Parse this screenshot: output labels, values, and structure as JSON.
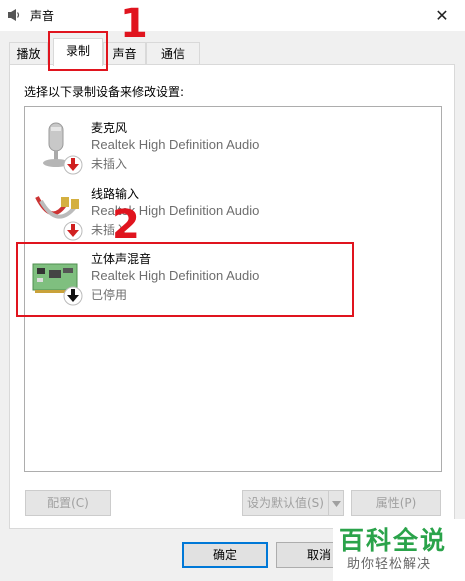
{
  "window": {
    "title": "声音",
    "close_glyph": "✕",
    "icon": "speaker-icon"
  },
  "tabs": [
    {
      "label": "播放",
      "active": false
    },
    {
      "label": "录制",
      "active": true
    },
    {
      "label": "声音",
      "active": false
    },
    {
      "label": "通信",
      "active": false
    }
  ],
  "instruction": "选择以下录制设备来修改设置:",
  "devices": [
    {
      "name": "麦克风",
      "driver": "Realtek High Definition Audio",
      "status": "未插入",
      "icon": "microphone-icon",
      "badge": "red-down-arrow"
    },
    {
      "name": "线路输入",
      "driver": "Realtek High Definition Audio",
      "status": "未插入",
      "icon": "line-in-cable-icon",
      "badge": "red-down-arrow"
    },
    {
      "name": "立体声混音",
      "driver": "Realtek High Definition Audio",
      "status": "已停用",
      "icon": "sound-card-icon",
      "badge": "black-down-arrow"
    }
  ],
  "buttons": {
    "configure": "配置(C)",
    "set_default": "设为默认值(S)",
    "properties": "属性(P)",
    "ok": "确定",
    "cancel": "取消"
  },
  "annotations": [
    "1",
    "2"
  ],
  "watermark": {
    "main": "百科全说",
    "sub": "助你轻松解决"
  },
  "colors": {
    "annotation": "#e0141e",
    "focus": "#0078d7",
    "watermark": "#2aa34a"
  }
}
